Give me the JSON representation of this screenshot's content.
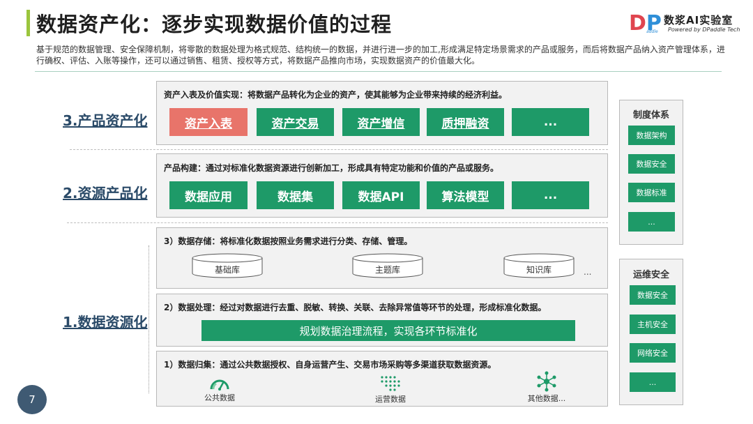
{
  "title": "数据资产化：逐步实现数据价值的过程",
  "logo": {
    "dp": "DP",
    "addle": "addle",
    "name": "数浆AI实验室",
    "sub": "Powered by DPaddle Tech"
  },
  "intro": "基于规范的数据管理、安全保障机制，将零散的数据处理为格式规范、结构统一的数据，并进行进一步的加工,形成满足特定场景需求的产品或服务，而后将数据产品纳入资产管理体系，进行确权、评估、入账等操作，还可以通过销售、租赁、授权等方式，将数据产品推向市场，实现数据资产的价值最大化。",
  "stage3": {
    "label": "3.产品资产化",
    "text": "资产入表及价值实现：将数据产品转化为企业的资产，使其能够为企业带来持续的经济利益。",
    "buttons": [
      "资产入表",
      "资产交易",
      "资产增信",
      "质押融资",
      "..."
    ]
  },
  "stage2": {
    "label": "2.资源产品化",
    "text": "产品构建：通过对标准化数据资源进行创新加工，形成具有特定功能和价值的产品或服务。",
    "buttons": [
      "数据应用",
      "数据集",
      "数据API",
      "算法模型",
      "..."
    ]
  },
  "stage1": {
    "label": "1.数据资源化",
    "storage": {
      "text": "3）数据存储：将标准化数据按照业务需求进行分类、存储、管理。",
      "dbs": [
        "基础库",
        "主题库",
        "知识库"
      ],
      "more": "..."
    },
    "processing": {
      "text": "2）数据处理：经过对数据进行去重、脱敏、转换、关联、去除异常值等环节的处理，形成标准化数据。",
      "bar": "规划数据治理流程，实现各环节标准化"
    },
    "collection": {
      "text": "1）数据归集：通过公共数据授权、自身运营产生、交易市场采购等多渠道获取数据资源。",
      "sources": [
        {
          "label": "公共数据",
          "icon": "gauge-icon"
        },
        {
          "label": "运营数据",
          "icon": "dot-matrix-icon"
        },
        {
          "label": "其他数据...",
          "icon": "network-icon"
        }
      ]
    }
  },
  "side1": {
    "title": "制度体系",
    "items": [
      "数据架构",
      "数据安全",
      "数据标准",
      "..."
    ]
  },
  "side2": {
    "title": "运维安全",
    "items": [
      "数据安全",
      "主机安全",
      "网络安全",
      "..."
    ]
  },
  "page_number": "7",
  "colors": {
    "green": "#1e9a68",
    "red": "#e8746a",
    "accent_bar": "#9bc53d",
    "stage_label": "#2a4a68"
  }
}
